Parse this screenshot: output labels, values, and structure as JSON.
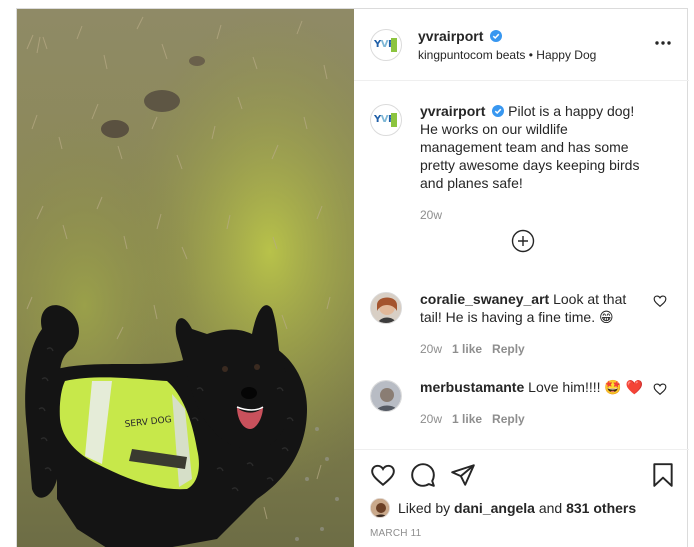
{
  "post": {
    "account": "yvrairport",
    "audio": "kingpuntocom beats • Happy Dog",
    "caption": "Pilot is a happy dog! He works on our wildlife management team and has some pretty awesome days keeping birds and planes safe!",
    "caption_age": "20w",
    "vest_text": "SERV DOG",
    "date": "MARCH 11"
  },
  "comments": [
    {
      "user": "coralie_swaney_art",
      "text": "Look at that tail! He is having a fine time. 😁",
      "age": "20w",
      "likes": "1 like",
      "reply": "Reply"
    },
    {
      "user": "merbustamante",
      "text": "Love him!!!! 🤩 ❤️",
      "age": "20w",
      "likes": "1 like",
      "reply": "Reply"
    }
  ],
  "likes": {
    "prefix": "Liked by",
    "user": "dani_angela",
    "conj": "and",
    "others": "831 others"
  },
  "icons": {
    "verified": "verified-badge-icon",
    "more": "more-options-icon",
    "load_more": "add-circle-icon",
    "like": "heart-icon",
    "comment": "comment-icon",
    "share": "paper-plane-icon",
    "save": "bookmark-icon"
  },
  "colors": {
    "verified": "#3897f0",
    "text": "#262626",
    "muted": "#8e8e8e",
    "vest": "#c7e84a"
  }
}
